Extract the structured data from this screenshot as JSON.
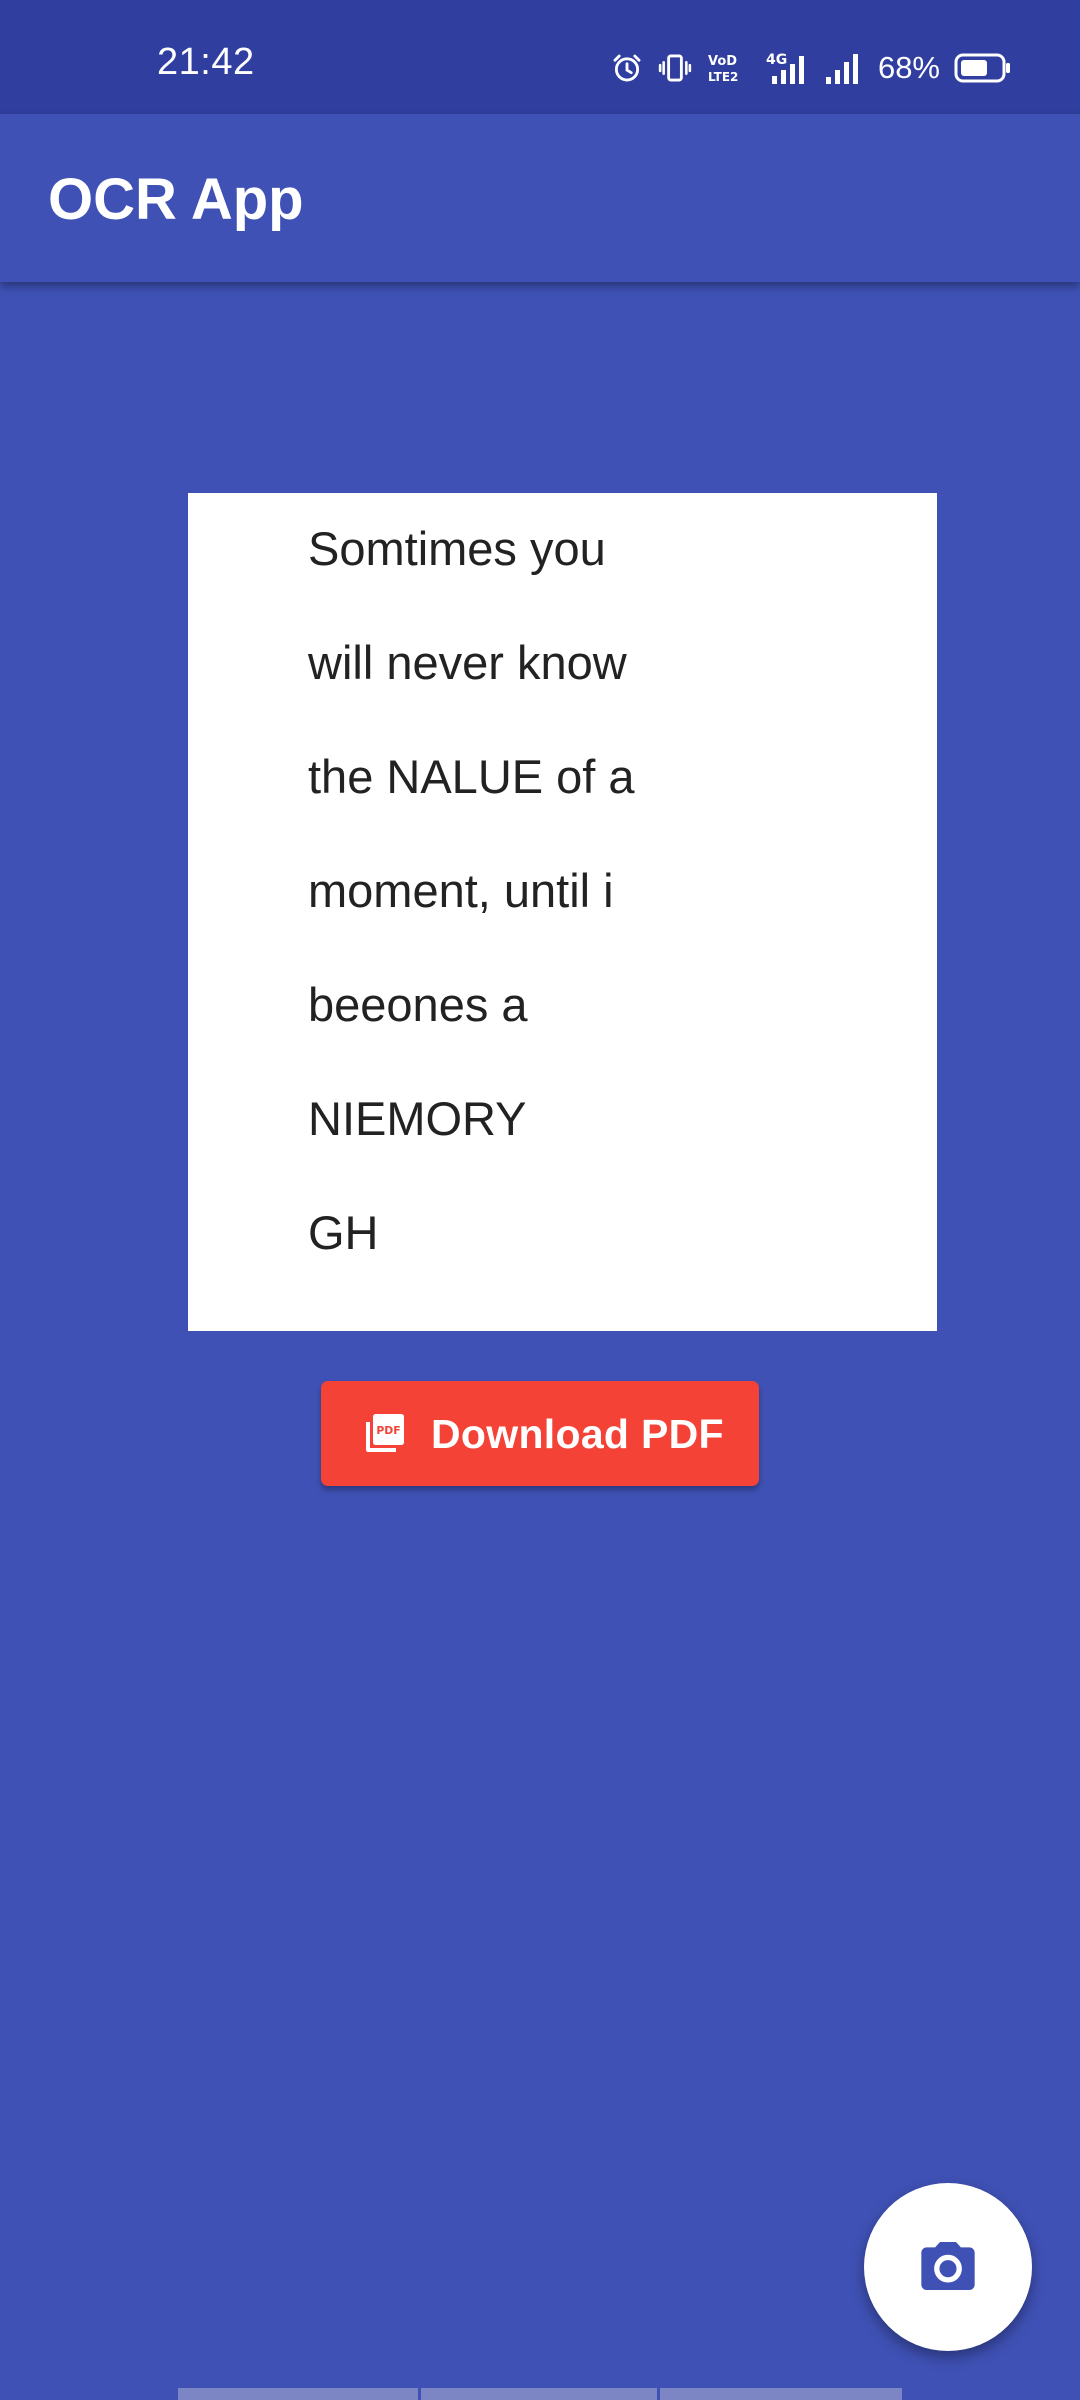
{
  "status_bar": {
    "time": "21:42",
    "network_label": "4G",
    "volte_label": "VoD LTE2",
    "battery_percent": "68%",
    "battery_level": 0.68,
    "icons": [
      "alarm-icon",
      "vibrate-icon",
      "volte-icon",
      "signal-4g-icon",
      "signal-icon",
      "battery-icon"
    ]
  },
  "app_bar": {
    "title": "OCR App"
  },
  "recognized_text": {
    "lines": [
      "Somtimes you",
      "will never know",
      "the NALUE of a",
      "moment, until i",
      "beeones a",
      "NIEMORY",
      "GH"
    ]
  },
  "download_button": {
    "label": "Download PDF",
    "icon": "pdf-icon"
  },
  "fab": {
    "icon": "camera-icon"
  },
  "colors": {
    "primary": "#3F51B5",
    "primary_dark": "#303F9F",
    "accent_red": "#F44336",
    "card": "#FFFFFF",
    "text": "#222222"
  }
}
